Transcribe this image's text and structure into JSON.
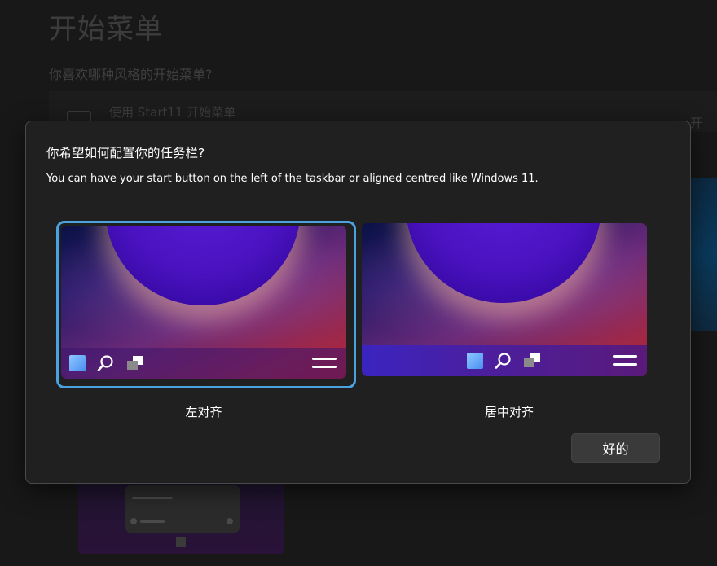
{
  "background": {
    "page_title": "开始菜单",
    "question": "你喜欢哪种风格的开始菜单?",
    "option_label": "使用 Start11 开始菜单",
    "right_fragment": "开"
  },
  "dialog": {
    "title": "你希望如何配置你的任务栏?",
    "description": "You can have your start button on the left of the taskbar or aligned centred like Windows 11.",
    "options": [
      {
        "label": "左对齐",
        "selected": true,
        "alignment": "left"
      },
      {
        "label": "居中对齐",
        "selected": false,
        "alignment": "center"
      }
    ],
    "ok_label": "好的"
  },
  "colors": {
    "selection_border": "#4aa3e0",
    "dialog_bg": "#202020",
    "button_bg": "#3a3a3a"
  },
  "icons": [
    "start-icon",
    "search-icon",
    "task-view-icon",
    "menu-icon"
  ]
}
